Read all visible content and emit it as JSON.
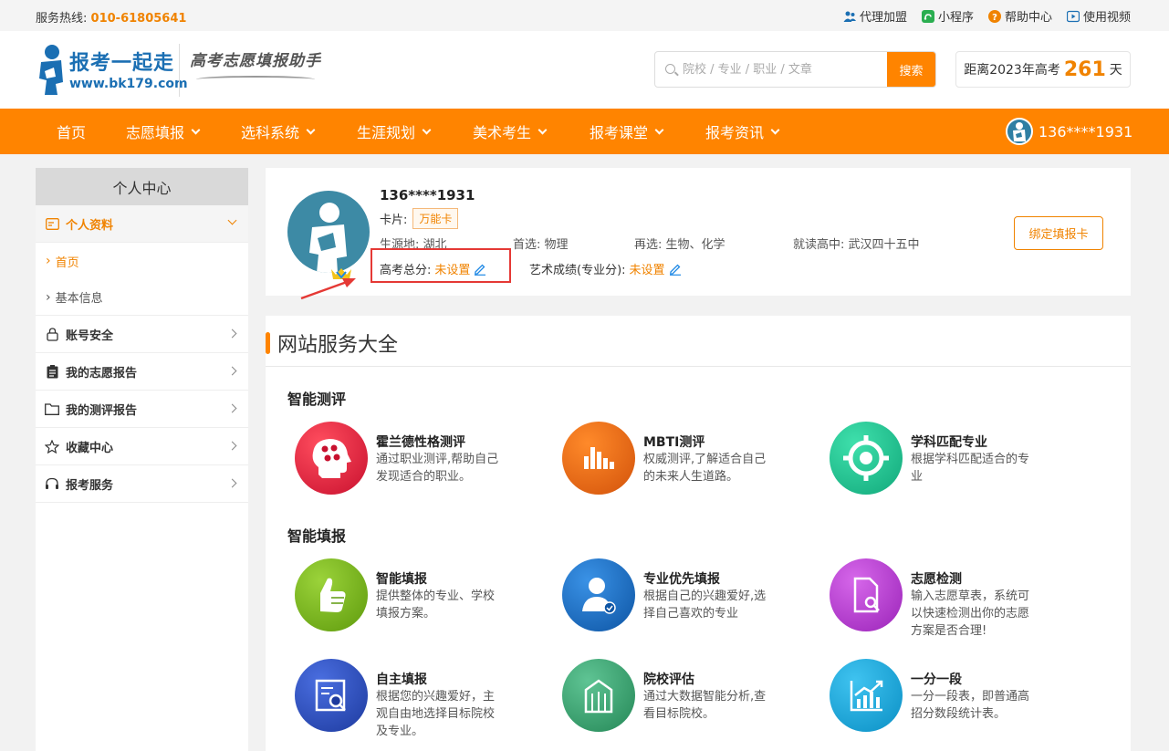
{
  "topbar": {
    "hotline_label": "服务热线:",
    "hotline_number": "010-61805641",
    "links": [
      {
        "label": "代理加盟",
        "icon": "agent-icon"
      },
      {
        "label": "小程序",
        "icon": "miniprogram-icon"
      },
      {
        "label": "帮助中心",
        "icon": "help-icon"
      },
      {
        "label": "使用视频",
        "icon": "video-icon"
      }
    ]
  },
  "header": {
    "logo_title": "报考一起走",
    "logo_url": "www.bk179.com",
    "slogan": "高考志愿填报助手",
    "search_placeholder": "院校 / 专业 / 职业 / 文章",
    "search_button": "搜索",
    "countdown_prefix": "距离2023年高考",
    "countdown_days": "261",
    "countdown_suffix": "天"
  },
  "nav": {
    "items": [
      "首页",
      "志愿填报",
      "选科系统",
      "生涯规划",
      "美术考生",
      "报考课堂",
      "报考资讯"
    ],
    "user": "136****1931"
  },
  "sidebar": {
    "title": "个人中心",
    "active_section": "个人资料",
    "subitems": [
      "首页",
      "基本信息"
    ],
    "sections": [
      {
        "label": "账号安全",
        "icon": "lock-icon"
      },
      {
        "label": "我的志愿报告",
        "icon": "clipboard-icon"
      },
      {
        "label": "我的测评报告",
        "icon": "folder-icon"
      },
      {
        "label": "收藏中心",
        "icon": "star-icon"
      },
      {
        "label": "报考服务",
        "icon": "headset-icon"
      }
    ]
  },
  "profile": {
    "username": "136****1931",
    "card_label": "卡片:",
    "card_type": "万能卡",
    "origin_label": "生源地:",
    "origin": "湖北",
    "first_choice_label": "首选:",
    "first_choice": "物理",
    "second_choice_label": "再选:",
    "second_choice": "生物、化学",
    "school_label": "就读高中:",
    "school": "武汉四十五中",
    "score_label": "高考总分:",
    "score_value": "未设置",
    "art_label": "艺术成绩(专业分):",
    "art_value": "未设置",
    "bind_button": "绑定填报卡"
  },
  "services": {
    "title": "网站服务大全",
    "groups": [
      {
        "name": "智能测评",
        "items": [
          {
            "title": "霍兰德性格测评",
            "desc": "通过职业测评,帮助自己发现适合的职业。",
            "icon": "holland-head-icon",
            "color": "#e0203a"
          },
          {
            "title": "MBTI测评",
            "desc": "权威测评,了解适合自己的未来人生道路。",
            "icon": "bar-chart-icon",
            "color": "#e8670f"
          },
          {
            "title": "学科匹配专业",
            "desc": "根据学科匹配适合的专业",
            "icon": "target-icon",
            "color": "#1fbf8f"
          }
        ]
      },
      {
        "name": "智能填报",
        "items": [
          {
            "title": "智能填报",
            "desc": "提供整体的专业、学校填报方案。",
            "icon": "thumbs-up-icon",
            "color": "#7cb518"
          },
          {
            "title": "专业优先填报",
            "desc": "根据自己的兴趣爱好,选择自己喜欢的专业",
            "icon": "user-check-icon",
            "color": "#1670c4"
          },
          {
            "title": "志愿检测",
            "desc": "输入志愿草表，系统可以快速检测出你的志愿方案是否合理!",
            "icon": "doc-search-icon",
            "color": "#b43ad2"
          },
          {
            "title": "自主填报",
            "desc": "根据您的兴趣爱好，主观自由地选择目标院校及专业。",
            "icon": "list-search-icon",
            "color": "#2a4bb8"
          },
          {
            "title": "院校评估",
            "desc": "通过大数据智能分析,查看目标院校。",
            "icon": "building-icon",
            "color": "#2f9e6e"
          },
          {
            "title": "一分一段",
            "desc": "一分一段表，即普通高招分数段统计表。",
            "icon": "trend-chart-icon",
            "color": "#17a6d8"
          }
        ]
      }
    ]
  }
}
